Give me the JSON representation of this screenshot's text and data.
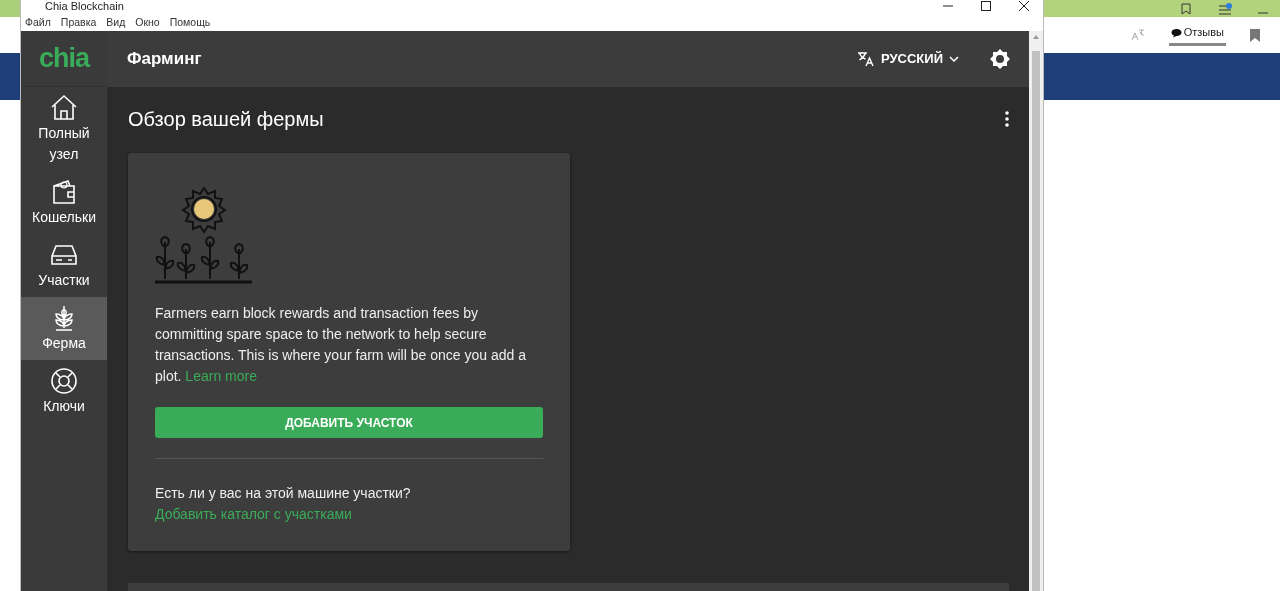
{
  "window": {
    "title": "Chia Blockchain"
  },
  "menu": [
    "Файл",
    "Правка",
    "Вид",
    "Окно",
    "Помощь"
  ],
  "header": {
    "logo": "chia",
    "title": "Фарминг",
    "language": "РУССКИЙ"
  },
  "sidebar": {
    "items": [
      {
        "label": "Полный узел",
        "selected": false
      },
      {
        "label": "Кошельки",
        "selected": false
      },
      {
        "label": "Участки",
        "selected": false
      },
      {
        "label": "Ферма",
        "selected": true
      },
      {
        "label": "Ключи",
        "selected": false
      }
    ]
  },
  "page": {
    "title": "Обзор вашей фермы"
  },
  "card": {
    "text": "Farmers earn block rewards and transaction fees by committing spare space to the network to help secure transactions. This is where your farm will be once you add a plot.",
    "text_link": "Learn more",
    "button": "ДОБАВИТЬ УЧАСТОК",
    "question": "Есть ли у вас на этой машине участки?",
    "question_link": "Добавить каталог с участками"
  },
  "background_browser": {
    "tab": "Отзывы"
  }
}
